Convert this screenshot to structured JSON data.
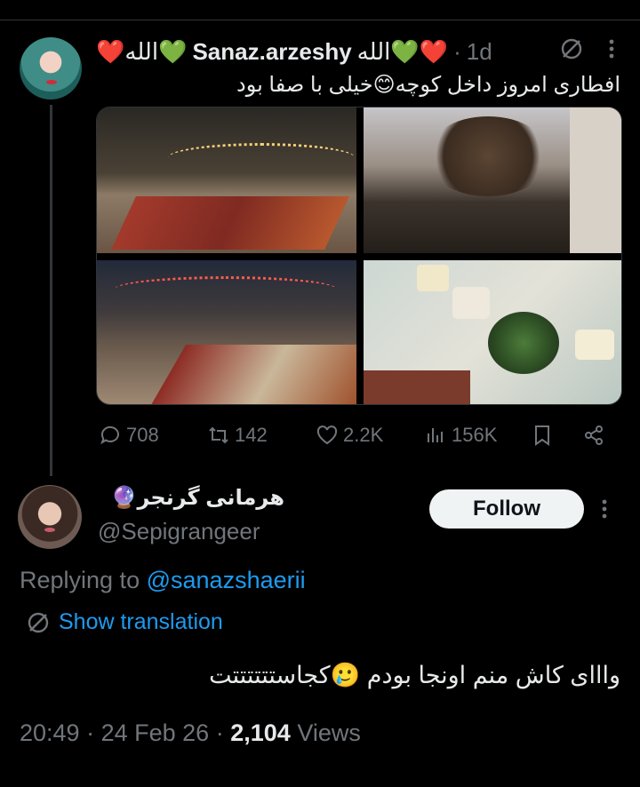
{
  "tweet": {
    "display_name": "Sanaz.arzeshy",
    "name_left_emoji": "❤️الله💚",
    "name_right_emoji": "الله💚❤️",
    "separator": "·",
    "time_ago": "1d",
    "text": "افطاری امروز داخل کوچه😊خیلی با صفا بود",
    "stats": {
      "replies": "708",
      "reposts": "142",
      "likes": "2.2K",
      "views": "156K"
    },
    "photos": [
      "street-rugs-photo",
      "alley-tree-photo",
      "lit-alley-photo",
      "food-table-photo"
    ]
  },
  "reply": {
    "display_name": "هرمانی گرنجر🔮",
    "handle": "@Sepigrangeer",
    "follow_label": "Follow",
    "replying_prefix": "Replying to",
    "replying_mention": "@sanazshaerii",
    "show_translation": "Show translation",
    "text": "وااای کاش منم اونجا بودم 🥲کجاستتتتتتت",
    "time": "20:49",
    "sep1": "·",
    "date": "24 Feb 26",
    "sep2": "·",
    "views_count": "2,104",
    "views_label": "Views"
  },
  "colors": {
    "background": "#000000",
    "text": "#e7e9ea",
    "muted": "#71767b",
    "link": "#1d9bf0",
    "button": "#eff3f4"
  }
}
